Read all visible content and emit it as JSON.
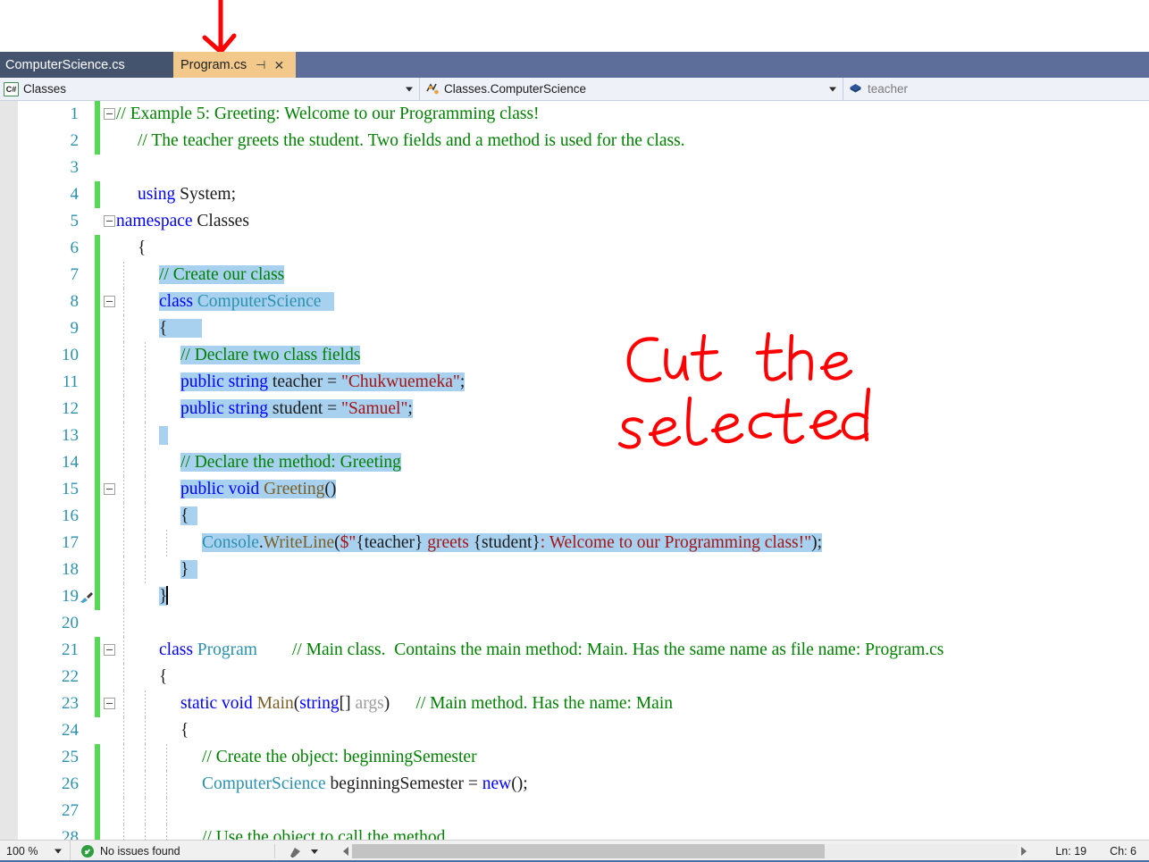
{
  "window": {
    "tabs": [
      {
        "label": "ComputerScience.cs",
        "active": false
      },
      {
        "label": "Program.cs",
        "active": true,
        "pin_icon": "pin-icon",
        "close_icon": "close-icon"
      }
    ]
  },
  "navigation_bar": {
    "project_selector": {
      "icon": "csharp-file-icon",
      "value": "Classes",
      "caret": "chevron-down-icon"
    },
    "type_selector": {
      "icon": "class-member-icon",
      "value": "Classes.ComputerScience",
      "caret": "chevron-down-icon"
    },
    "member_selector": {
      "icon": "field-icon",
      "value": "teacher"
    }
  },
  "annotations": {
    "handwriting_line1": "Cut  the",
    "handwriting_line2": "selected",
    "handwriting_color": "#ff0000",
    "arrow": "red-down-arrow pointing at Program.cs tab"
  },
  "editor": {
    "selection_color": "#a8d1f0",
    "change_bar_color": "#57d957",
    "lines": [
      {
        "n": 1,
        "change": true,
        "fold": "minus",
        "guides": 0,
        "indent": 0,
        "tokens": [
          {
            "t": "// Example 5: Greeting: Welcome to our Programming class!",
            "c": "cmt"
          }
        ]
      },
      {
        "n": 2,
        "change": true,
        "fold": "",
        "guides": 0,
        "indent": 1,
        "tokens": [
          {
            "t": "// The teacher greets the student. Two fields and a method is used for the class.",
            "c": "cmt"
          }
        ]
      },
      {
        "n": 3,
        "change": false,
        "fold": "",
        "guides": 0,
        "indent": 0,
        "tokens": []
      },
      {
        "n": 4,
        "change": true,
        "fold": "",
        "guides": 0,
        "indent": 1,
        "tokens": [
          {
            "t": "using ",
            "c": "kw"
          },
          {
            "t": "System;",
            "c": "plain"
          }
        ]
      },
      {
        "n": 5,
        "change": false,
        "fold": "minus",
        "guides": 0,
        "indent": 0,
        "tokens": [
          {
            "t": "namespace ",
            "c": "kw"
          },
          {
            "t": "Classes",
            "c": "plain"
          }
        ]
      },
      {
        "n": 6,
        "change": true,
        "fold": "",
        "guides": 0,
        "indent": 1,
        "tokens": [
          {
            "t": "{",
            "c": "plain"
          }
        ]
      },
      {
        "n": 7,
        "change": true,
        "fold": "",
        "guides": 1,
        "indent": 2,
        "tokens": [
          {
            "t": "// Create our class",
            "c": "cmt",
            "sel": true
          }
        ]
      },
      {
        "n": 8,
        "change": true,
        "fold": "minus",
        "guides": 1,
        "indent": 2,
        "tokens": [
          {
            "t": "class ",
            "c": "kw",
            "sel": true
          },
          {
            "t": "ComputerScience",
            "c": "type",
            "sel": true
          },
          {
            "t": "   ",
            "c": "plain",
            "sel": true
          }
        ]
      },
      {
        "n": 9,
        "change": true,
        "fold": "",
        "guides": 1,
        "indent": 2,
        "tokens": [
          {
            "t": "{",
            "c": "plain",
            "sel": true
          },
          {
            "t": "        ",
            "c": "plain",
            "sel": true
          }
        ]
      },
      {
        "n": 10,
        "change": true,
        "fold": "",
        "guides": 2,
        "indent": 3,
        "tokens": [
          {
            "t": "// Declare two class fields",
            "c": "cmt",
            "sel": true
          }
        ]
      },
      {
        "n": 11,
        "change": true,
        "fold": "",
        "guides": 2,
        "indent": 3,
        "tokens": [
          {
            "t": "public string ",
            "c": "kw",
            "sel": true
          },
          {
            "t": "teacher = ",
            "c": "plain",
            "sel": true
          },
          {
            "t": "\"Chukwuemeka\"",
            "c": "str",
            "sel": true
          },
          {
            "t": ";",
            "c": "plain",
            "sel": true
          }
        ]
      },
      {
        "n": 12,
        "change": true,
        "fold": "",
        "guides": 2,
        "indent": 3,
        "tokens": [
          {
            "t": "public string ",
            "c": "kw",
            "sel": true
          },
          {
            "t": "student = ",
            "c": "plain",
            "sel": true
          },
          {
            "t": "\"Samuel\"",
            "c": "str",
            "sel": true
          },
          {
            "t": ";",
            "c": "plain",
            "sel": true
          }
        ]
      },
      {
        "n": 13,
        "change": true,
        "fold": "",
        "guides": 2,
        "indent": 2,
        "tokens": [
          {
            "t": "  ",
            "c": "plain",
            "sel": true
          }
        ]
      },
      {
        "n": 14,
        "change": true,
        "fold": "",
        "guides": 2,
        "indent": 3,
        "tokens": [
          {
            "t": "// Declare the method: Greeting",
            "c": "cmt",
            "sel": true
          }
        ]
      },
      {
        "n": 15,
        "change": true,
        "fold": "minus",
        "guides": 2,
        "indent": 3,
        "tokens": [
          {
            "t": "public void ",
            "c": "kw",
            "sel": true
          },
          {
            "t": "Greeting",
            "c": "meth",
            "sel": true
          },
          {
            "t": "()",
            "c": "plain",
            "sel": true
          }
        ]
      },
      {
        "n": 16,
        "change": true,
        "fold": "",
        "guides": 2,
        "indent": 3,
        "tokens": [
          {
            "t": "{",
            "c": "plain",
            "sel": true
          },
          {
            "t": "  ",
            "c": "plain",
            "sel": true
          }
        ]
      },
      {
        "n": 17,
        "change": true,
        "fold": "",
        "guides": 3,
        "indent": 4,
        "tokens": [
          {
            "t": "Console",
            "c": "type",
            "sel": true
          },
          {
            "t": ".",
            "c": "plain",
            "sel": true
          },
          {
            "t": "WriteLine",
            "c": "meth",
            "sel": true
          },
          {
            "t": "(",
            "c": "plain",
            "sel": true
          },
          {
            "t": "$\"",
            "c": "str",
            "sel": true
          },
          {
            "t": "{teacher}",
            "c": "plain",
            "sel": true
          },
          {
            "t": " greets ",
            "c": "str",
            "sel": true
          },
          {
            "t": "{student}",
            "c": "plain",
            "sel": true
          },
          {
            "t": ": Welcome to our Programming class!\"",
            "c": "str",
            "sel": true
          },
          {
            "t": ");",
            "c": "plain",
            "sel": true
          }
        ]
      },
      {
        "n": 18,
        "change": true,
        "fold": "",
        "guides": 2,
        "indent": 3,
        "tokens": [
          {
            "t": "}",
            "c": "plain",
            "sel": true
          },
          {
            "t": "  ",
            "c": "plain",
            "sel": true
          }
        ]
      },
      {
        "n": 19,
        "change": true,
        "fold": "",
        "guides": 1,
        "indent": 2,
        "brush": "quick-actions-brush-icon",
        "caret_after": true,
        "tokens": [
          {
            "t": "}",
            "c": "plain",
            "sel": true
          }
        ]
      },
      {
        "n": 20,
        "change": false,
        "fold": "",
        "guides": 1,
        "indent": 0,
        "tokens": []
      },
      {
        "n": 21,
        "change": true,
        "fold": "minus",
        "guides": 1,
        "indent": 2,
        "tokens": [
          {
            "t": "class ",
            "c": "kw"
          },
          {
            "t": "Program",
            "c": "type"
          },
          {
            "t": "        ",
            "c": "plain"
          },
          {
            "t": "// Main class.  Contains the main method: Main. Has the same name as file name: Program.cs",
            "c": "cmt"
          }
        ]
      },
      {
        "n": 22,
        "change": true,
        "fold": "",
        "guides": 1,
        "indent": 2,
        "tokens": [
          {
            "t": "{",
            "c": "plain"
          }
        ]
      },
      {
        "n": 23,
        "change": true,
        "fold": "minus",
        "guides": 2,
        "indent": 3,
        "tokens": [
          {
            "t": "static void ",
            "c": "kw"
          },
          {
            "t": "Main",
            "c": "meth"
          },
          {
            "t": "(",
            "c": "plain"
          },
          {
            "t": "string",
            "c": "kw"
          },
          {
            "t": "[] ",
            "c": "plain"
          },
          {
            "t": "args",
            "c": "param"
          },
          {
            "t": ")",
            "c": "plain"
          },
          {
            "t": "      ",
            "c": "plain"
          },
          {
            "t": "// Main method. Has the name: Main",
            "c": "cmt"
          }
        ]
      },
      {
        "n": 24,
        "change": false,
        "fold": "",
        "guides": 2,
        "indent": 3,
        "tokens": [
          {
            "t": "{",
            "c": "plain"
          }
        ]
      },
      {
        "n": 25,
        "change": true,
        "fold": "",
        "guides": 3,
        "indent": 4,
        "tokens": [
          {
            "t": "// Create the object: beginningSemester",
            "c": "cmt"
          }
        ]
      },
      {
        "n": 26,
        "change": true,
        "fold": "",
        "guides": 3,
        "indent": 4,
        "tokens": [
          {
            "t": "ComputerScience",
            "c": "type"
          },
          {
            "t": " beginningSemester = ",
            "c": "plain"
          },
          {
            "t": "new",
            "c": "kw"
          },
          {
            "t": "();",
            "c": "plain"
          }
        ]
      },
      {
        "n": 27,
        "change": true,
        "fold": "",
        "guides": 3,
        "indent": 0,
        "tokens": []
      },
      {
        "n": 28,
        "change": true,
        "fold": "",
        "guides": 3,
        "indent": 4,
        "tokens": [
          {
            "t": "// Use the object to call the method",
            "c": "cmt"
          }
        ]
      }
    ]
  },
  "status_bar": {
    "zoom": "100 %",
    "zoom_caret": "chevron-down-icon",
    "issues_icon": "success-check-icon",
    "issues_text": "No issues found",
    "pen_icon": "pen-icon",
    "pen_caret": "chevron-down-icon",
    "scroll_left_icon": "scroll-left-arrow",
    "scroll_right_icon": "scroll-right-arrow",
    "line_label": "Ln: 19",
    "col_label": "Ch: 6"
  }
}
